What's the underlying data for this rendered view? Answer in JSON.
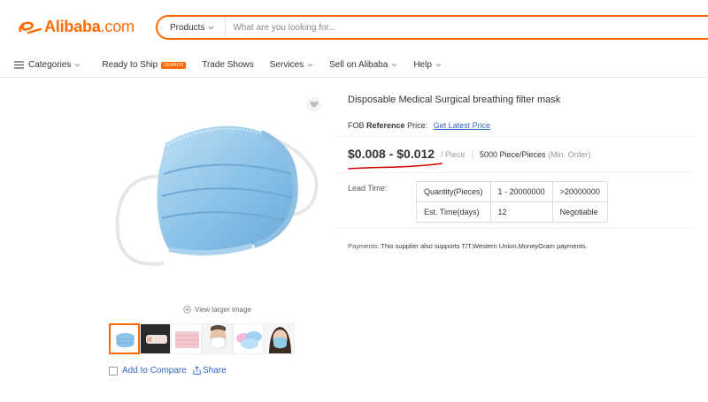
{
  "header": {
    "logo_text": "Alibaba",
    "logo_suffix": ".com",
    "search_category": "Products",
    "search_placeholder": "What are you looking for..."
  },
  "nav": {
    "items": [
      {
        "label": "Categories",
        "has_menu": true
      },
      {
        "label": "Ready to Ship",
        "badge": "SEARCH"
      },
      {
        "label": "Trade Shows"
      },
      {
        "label": "Services",
        "has_menu": true
      },
      {
        "label": "Sell on Alibaba",
        "has_menu": true
      },
      {
        "label": "Help",
        "has_menu": true
      }
    ]
  },
  "gallery": {
    "view_larger": "View larger image",
    "thumbnails": [
      "mask-blue",
      "mask-roll",
      "mask-pink",
      "mask-on-man",
      "mask-pile",
      "mask-on-woman"
    ],
    "active_index": 0
  },
  "actions": {
    "compare": "Add to Compare",
    "share": "Share"
  },
  "product": {
    "title": "Disposable Medical Surgical breathing filter mask",
    "fob_prefix": "FOB",
    "fob_bold": "Reference",
    "fob_suffix": "Price:",
    "fob_link": "Get Latest Price",
    "price_range": "$0.008 - $0.012",
    "price_unit": "/ Piece",
    "separator": "|",
    "min_order_qty": "5000 Piece/Pieces",
    "min_order_label": "(Min. Order)"
  },
  "lead_time": {
    "label": "Lead Time:",
    "rows": [
      [
        "Quantity(Pieces)",
        "1 - 20000000",
        ">20000000"
      ],
      [
        "Est. Time(days)",
        "12",
        "Negotiable"
      ]
    ]
  },
  "payments": {
    "label": "Payments:",
    "text": "This supplier also supports T/T,Western Union,MoneyGram payments."
  },
  "colors": {
    "brand": "#ff6a00",
    "link": "#3366cc",
    "annotation": "#d40000"
  }
}
